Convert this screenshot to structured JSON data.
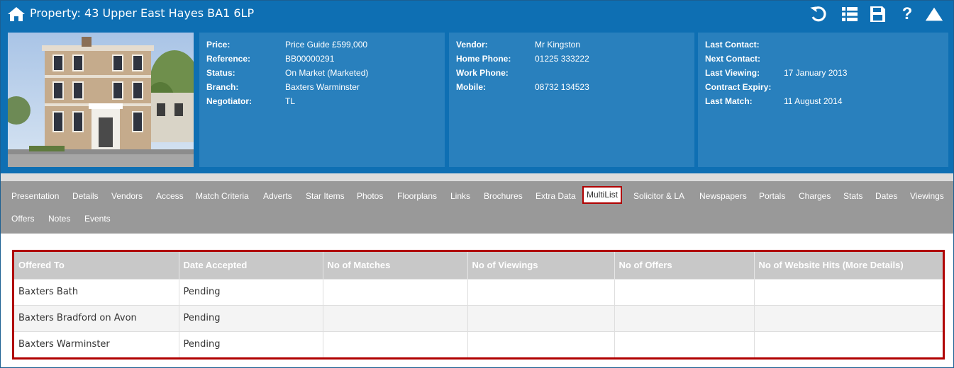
{
  "header": {
    "title": "Property: 43 Upper East Hayes BA1 6LP",
    "toolbar_icons": [
      "home-icon",
      "undo-icon",
      "list-icon",
      "save-icon",
      "help-icon",
      "collapse-icon"
    ],
    "toolbar_help_glyph": "?"
  },
  "property": {
    "rows": [
      {
        "label": "Price:",
        "value": "Price Guide £599,000"
      },
      {
        "label": "Reference:",
        "value": "BB00000291"
      },
      {
        "label": "Status:",
        "value": "On Market (Marketed)"
      },
      {
        "label": "Branch:",
        "value": "Baxters Warminster"
      },
      {
        "label": "Negotiator:",
        "value": "TL"
      }
    ]
  },
  "vendor": {
    "rows": [
      {
        "label": "Vendor:",
        "value": "Mr Kingston"
      },
      {
        "label": "Home Phone:",
        "value": "01225 333222"
      },
      {
        "label": "Work Phone:",
        "value": ""
      },
      {
        "label": "Mobile:",
        "value": "08732 134523"
      }
    ]
  },
  "contact": {
    "rows": [
      {
        "label": "Last Contact:",
        "value": ""
      },
      {
        "label": "Next Contact:",
        "value": ""
      },
      {
        "label": "Last Viewing:",
        "value": "17 January 2013"
      },
      {
        "label": "Contract Expiry:",
        "value": ""
      },
      {
        "label": "Last Match:",
        "value": "11 August 2014"
      }
    ]
  },
  "tabs": [
    "Presentation",
    "Details",
    "Vendors",
    "Access",
    "Match Criteria",
    "Adverts",
    "Star Items",
    "Photos",
    "Floorplans",
    "Links",
    "Brochures",
    "Extra Data",
    "MultiList",
    "Solicitor & LA",
    "Newspapers",
    "Portals",
    "Charges",
    "Stats",
    "Dates",
    "Viewings",
    "Offers",
    "Notes",
    "Events"
  ],
  "active_tab": "MultiList",
  "table": {
    "columns": [
      "Offered To",
      "Date Accepted",
      "No of Matches",
      "No of Viewings",
      "No of Offers",
      "No of Website Hits (More Details)"
    ],
    "rows": [
      [
        "Baxters Bath",
        "Pending",
        "",
        "",
        "",
        ""
      ],
      [
        "Baxters Bradford on Avon",
        "Pending",
        "",
        "",
        "",
        ""
      ],
      [
        "Baxters Warminster",
        "Pending",
        "",
        "",
        "",
        ""
      ]
    ]
  },
  "colors": {
    "header_bg": "#0e6fb3",
    "panel_bg": "#2980bd",
    "tabs_bg": "#999999",
    "highlight_border": "#b00000"
  }
}
